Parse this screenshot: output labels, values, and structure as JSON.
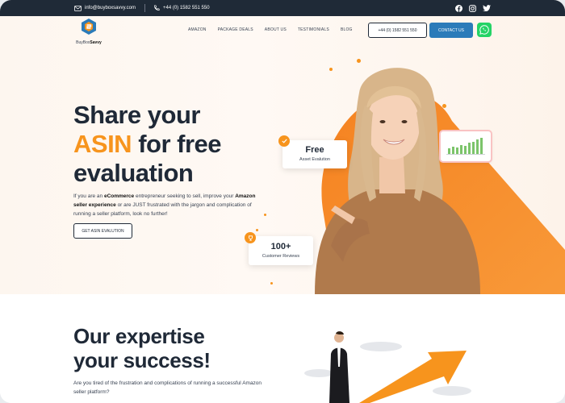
{
  "topbar": {
    "email": "info@buyboxsavvy.com",
    "phone": "+44 (0) 1582 551 550",
    "social": [
      "facebook-icon",
      "instagram-icon",
      "twitter-icon"
    ]
  },
  "logo": {
    "text_regular": "BuyBox",
    "text_bold": "Savvy"
  },
  "nav": {
    "items": [
      "AMAZON",
      "PACKAGE DEALS",
      "ABOUT US",
      "TESTIMONIALS",
      "BLOG"
    ]
  },
  "header_buttons": {
    "phone_label": "+44 (0) 1582 551 550",
    "contact_label": "CONTACT US"
  },
  "hero": {
    "title_line1": "Share your",
    "title_highlight": "ASIN",
    "title_line2_rest": " for free",
    "title_line3": "evaluation",
    "lead_1": "If you are an ",
    "lead_bold_1": "eCommerce",
    "lead_2": " entrepreneur seeking to sell, improve your ",
    "lead_bold_2": "Amazon seller experience",
    "lead_3": " or are JUST frustrated with the jargon and complication of running a seller platform, look no further!",
    "cta_label": "GET ASIN EVALUTION",
    "card_free_title": "Free",
    "card_free_sub": "Asset Evalution",
    "card_reviews_title": "100+",
    "card_reviews_sub": "Customer Reviews"
  },
  "section2": {
    "title_line1": "Our expertise",
    "title_line2": "your success!",
    "paragraph": "Are you tired of the frustration and complications of running a successful Amazon seller platform?"
  },
  "colors": {
    "accent": "#f7941d",
    "dark": "#1f2a37",
    "contact_blue": "#2b7bb9",
    "whatsapp": "#25d366"
  }
}
